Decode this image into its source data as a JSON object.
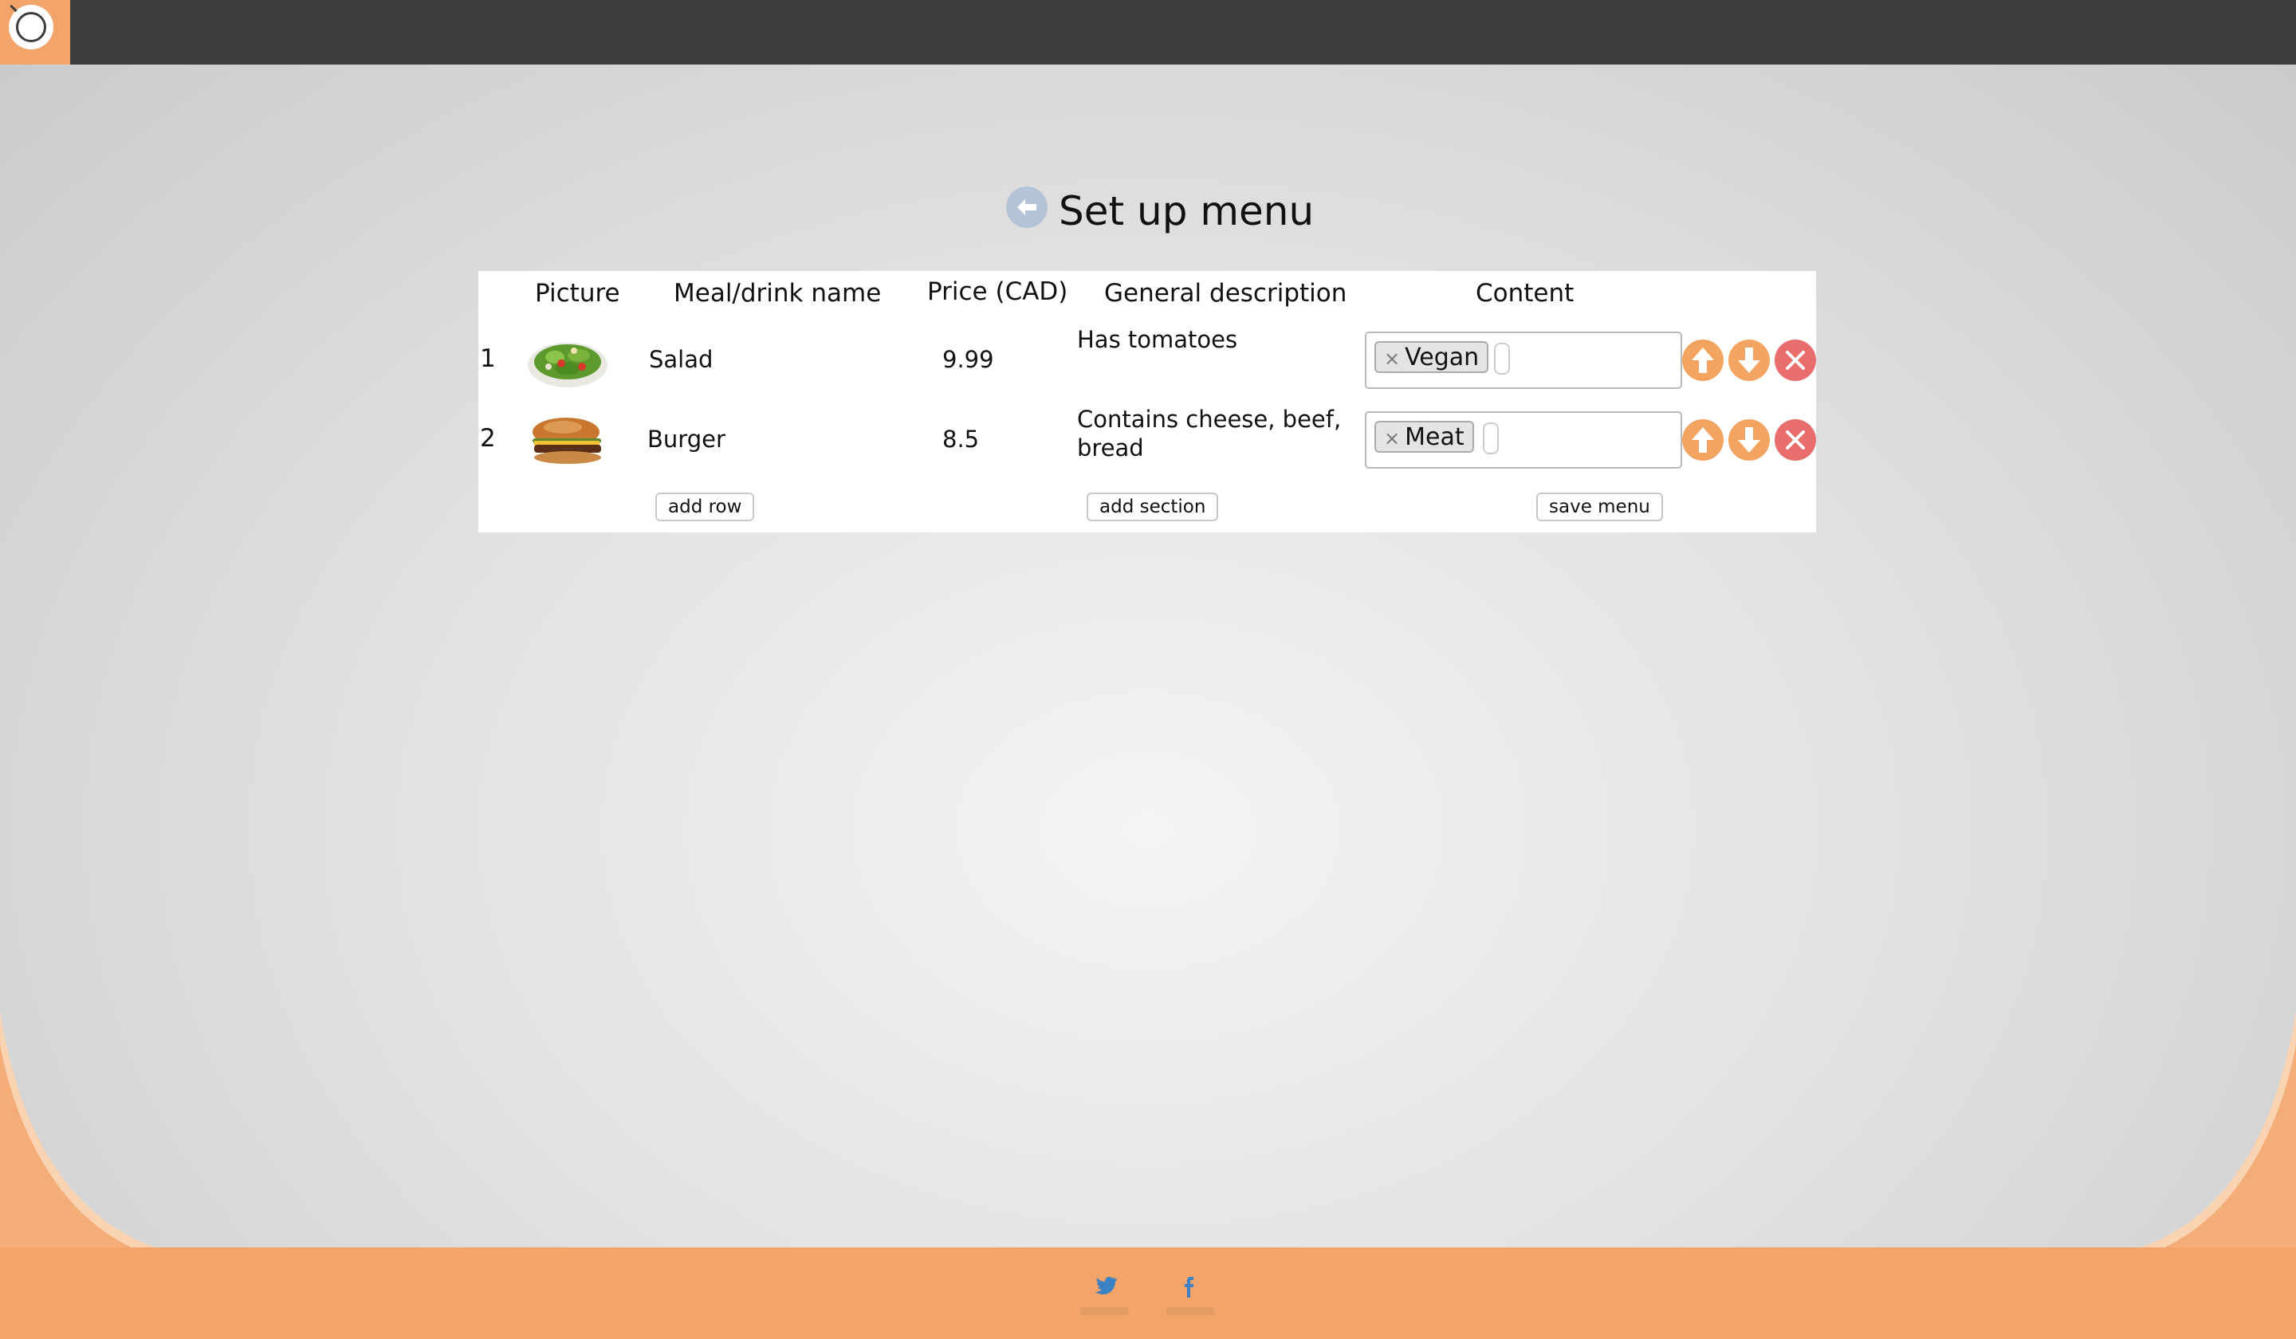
{
  "header": {
    "logo_icon": "magnifier-logo-icon"
  },
  "page": {
    "title": "Set up menu",
    "back_icon": "back-arrow-icon"
  },
  "table": {
    "columns": [
      "Picture",
      "Meal/drink name",
      "Price (CAD)",
      "General description",
      "Content"
    ],
    "rows": [
      {
        "number": "1",
        "picture": "salad-image",
        "name": "Salad",
        "price": "9.99",
        "description": "Has tomatoes",
        "tags": [
          "Vegan"
        ]
      },
      {
        "number": "2",
        "picture": "burger-image",
        "name": "Burger",
        "price": "8.5",
        "description": "Contains cheese, beef, bread",
        "tags": [
          "Meat"
        ]
      }
    ],
    "tag_remove_symbol": "×"
  },
  "actions": {
    "add_row": "add row",
    "add_section": "add section",
    "save_menu": "save menu"
  },
  "footer": {
    "twitter": "twitter-icon",
    "facebook": "facebook-icon"
  },
  "colors": {
    "topbar": "#3d3d3d",
    "accent": "#f3a46a",
    "move_button": "#f2a460",
    "delete_button": "#e86d6d"
  }
}
